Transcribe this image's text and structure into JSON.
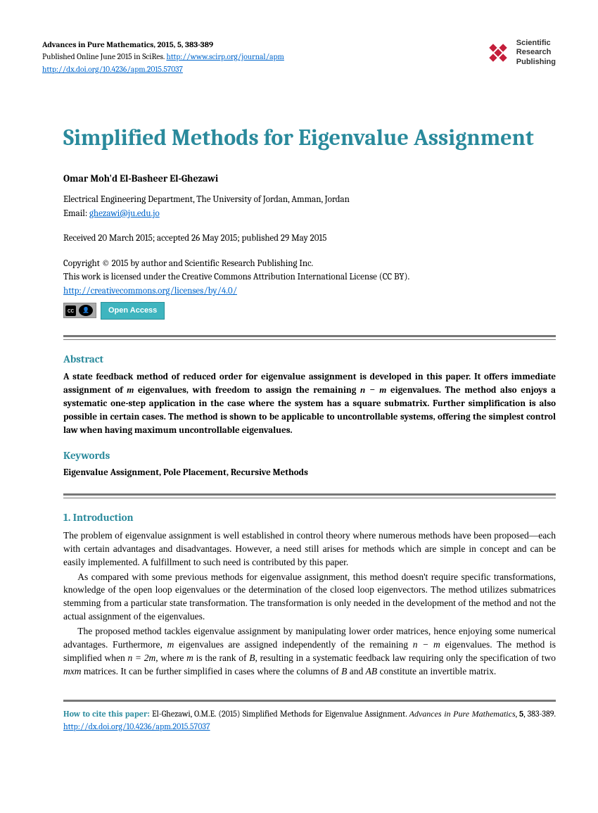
{
  "header": {
    "journal_info": "Advances in Pure Mathematics, 2015, 5, 383-389",
    "pub_line_prefix": "Published Online June 2015 in SciRes. ",
    "journal_url": "http://www.scirp.org/journal/apm",
    "doi_url": "http://dx.doi.org/10.4236/apm.2015.57037",
    "publisher_logo": {
      "line1": "Scientific",
      "line2": "Research",
      "line3": "Publishing"
    }
  },
  "title": "Simplified Methods for Eigenvalue Assignment",
  "author": {
    "name": "Omar Moh'd El-Basheer El-Ghezawi",
    "affiliation": "Electrical Engineering Department, The University of Jordan, Amman, Jordan",
    "email_label": "Email: ",
    "email_link": "ghezawi@ju.edu.jo"
  },
  "dates": "Received 20 March 2015; accepted 26 May 2015; published 29 May 2015",
  "copyright": {
    "line1": "Copyright © 2015 by author and Scientific Research Publishing Inc.",
    "line2": "This work is licensed under the Creative Commons Attribution International License (CC BY).",
    "license_url": "http://creativecommons.org/licenses/by/4.0/",
    "cc_label": "cc",
    "by_label": "BY",
    "open_access": "Open Access"
  },
  "abstract": {
    "heading": "Abstract",
    "text_parts": {
      "p1": "A state feedback method of reduced order for eigenvalue assignment is developed in this paper. It offers immediate assignment of ",
      "m1": "m",
      "p2": " eigenvalues, with freedom to assign the remaining ",
      "nm1": "n − m",
      "p3": " eigenvalues. The method also enjoys a systematic one-step application in the case where the system has a square submatrix. Further simplification is also possible in certain cases. The method is shown to be applicable to uncontrollable systems, offering the simplest control law when having maximum uncontrollable eigenvalues."
    }
  },
  "keywords": {
    "heading": "Keywords",
    "text": "Eigenvalue Assignment, Pole Placement, Recursive Methods"
  },
  "intro": {
    "heading": "1. Introduction",
    "p1": "The problem of eigenvalue assignment is well established in control theory where numerous methods have been proposed—each with certain advantages and disadvantages. However, a need still arises for methods which are simple in concept and can be easily implemented. A fulfillment to such need is contributed by this paper.",
    "p2": "As compared with some previous methods for eigenvalue assignment, this method doesn't require specific transformations, knowledge of the open loop eigenvalues or the determination of the closed loop eigenvectors. The method utilizes submatrices stemming from a particular state transformation. The transformation is only needed in the development of the method and not the actual assignment of the eigenvalues.",
    "p3_parts": {
      "a": "The proposed method tackles eigenvalue assignment by manipulating lower order matrices, hence enjoying some numerical advantages. Furthermore, ",
      "m": "m",
      "b": " eigenvalues are assigned independently of the remaining ",
      "nm": "n − m",
      "c": " eigenvalues. The method is simplified when ",
      "n2m": "n = 2m",
      "d": ", where ",
      "m2": "m",
      "e": " is the rank of ",
      "B": "B",
      "f": ", resulting in a systematic feedback law requiring only the specification of two ",
      "mxm": "mxm",
      "g": " matrices. It can be further simplified in cases where the columns of ",
      "B2": "B",
      "h": " and ",
      "AB": "AB",
      "i": " constitute an invertible matrix."
    }
  },
  "footer": {
    "lead": "How to cite this paper:",
    "text1": " El-Ghezawi, O.M.E. (2015) Simplified Methods for Eigenvalue Assignment. ",
    "cite_journal": "Advances in Pure Mathematics",
    "text2": ", ",
    "vol": "5",
    "text3": ", 383-389. ",
    "doi_url": "http://dx.doi.org/10.4236/apm.2015.57037"
  }
}
